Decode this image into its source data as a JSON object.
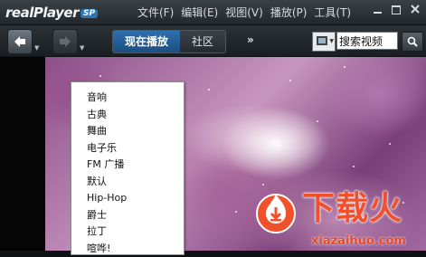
{
  "app": {
    "logo_text": "realPlayer",
    "logo_badge": "SP"
  },
  "menubar": {
    "items": [
      "文件(F)",
      "编辑(E)",
      "视图(V)",
      "播放(P)",
      "工具(T)"
    ]
  },
  "window_controls": [
    "minimize-icon",
    "maximize-icon",
    "close-icon"
  ],
  "toolbar": {
    "back_icon": "arrow-left-icon",
    "forward_icon": "arrow-right-icon",
    "tabs": [
      {
        "label": "现在播放",
        "active": true
      },
      {
        "label": "社区",
        "active": false
      }
    ],
    "more_label": "»",
    "search_mode_icon": "video-film-icon",
    "search_placeholder": "搜索视频",
    "search_button_icon": "magnifier-icon"
  },
  "preset_menu": {
    "items": [
      "音响",
      "古典",
      "舞曲",
      "电子乐",
      "FM 广播",
      "默认",
      "Hip-Hop",
      "爵士",
      "拉丁",
      "喧哗!"
    ]
  },
  "watermark": {
    "title": "下载火",
    "url": "xiazaihuo.com",
    "accent": "#f0502a"
  }
}
